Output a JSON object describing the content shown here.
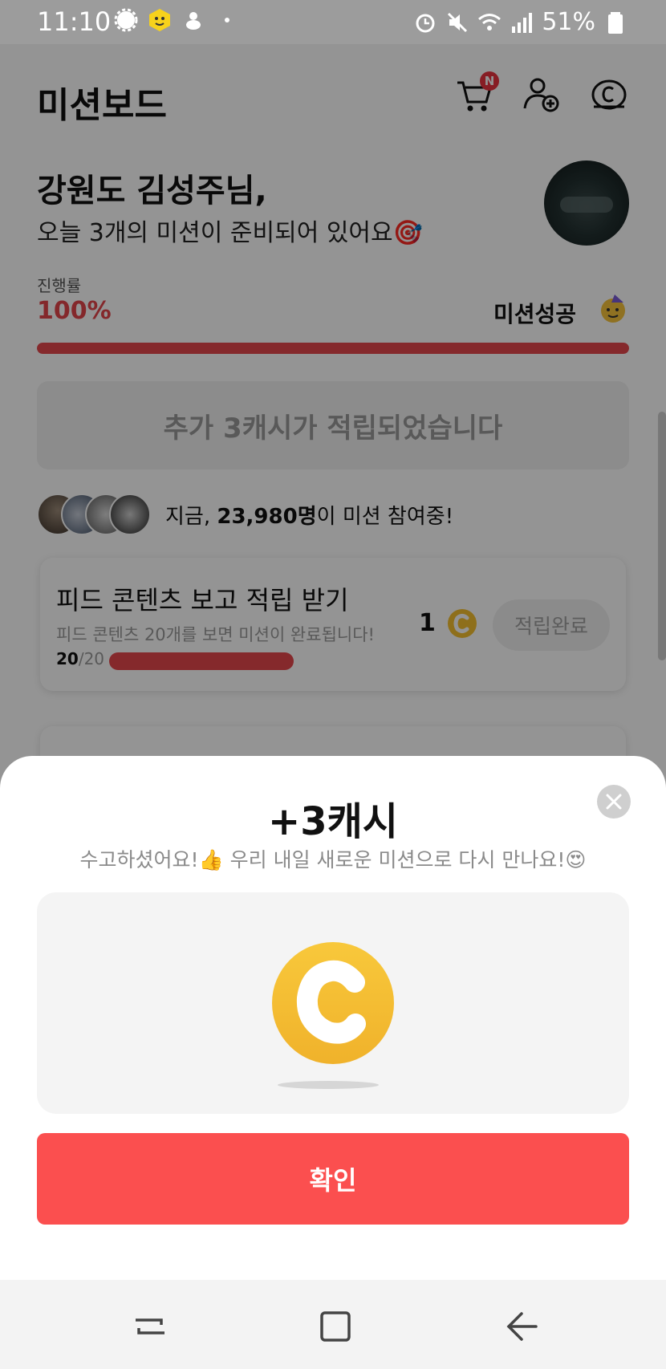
{
  "status_bar": {
    "time": "11:10",
    "battery": "51%",
    "icons": [
      "gear-icon",
      "emoji-badge-icon",
      "pet-icon",
      "dot-icon",
      "alarm-icon",
      "mute-icon",
      "wifi-icon",
      "signal-icon",
      "battery-icon"
    ]
  },
  "header": {
    "title": "미션보드",
    "cart_badge": "N",
    "icons": [
      "cart-icon",
      "add-friend-icon",
      "cash-coin-icon"
    ]
  },
  "greeting": {
    "name": "강원도 김성주님,",
    "subtitle": "오늘 3개의 미션이 준비되어 있어요🎯"
  },
  "progress": {
    "label": "진행률",
    "value": "100%",
    "fraction": 1.0,
    "status": "미션성공",
    "status_emoji": "party-face-icon"
  },
  "bonus": {
    "text": "추가 3캐시가 적립되었습니다"
  },
  "participants": {
    "prefix": "지금, ",
    "count": "23,980명",
    "suffix": "이 미션 참여중!"
  },
  "mission": {
    "title": "피드 콘텐츠 보고 적립 받기",
    "description": "피드 콘텐츠 20개를 보면 미션이 완료됩니다!",
    "progress_done": "20",
    "progress_total": "/20",
    "reward": "1",
    "button": "적립완료"
  },
  "sheet": {
    "title": "+3캐시",
    "subtitle": "수고하셨어요!👍 우리 내일 새로운 미션으로 다시 만나요!😍",
    "confirm": "확인"
  },
  "colors": {
    "accent": "#fb4f4f",
    "progress": "#e6474d",
    "coin": "#f5c02f"
  }
}
